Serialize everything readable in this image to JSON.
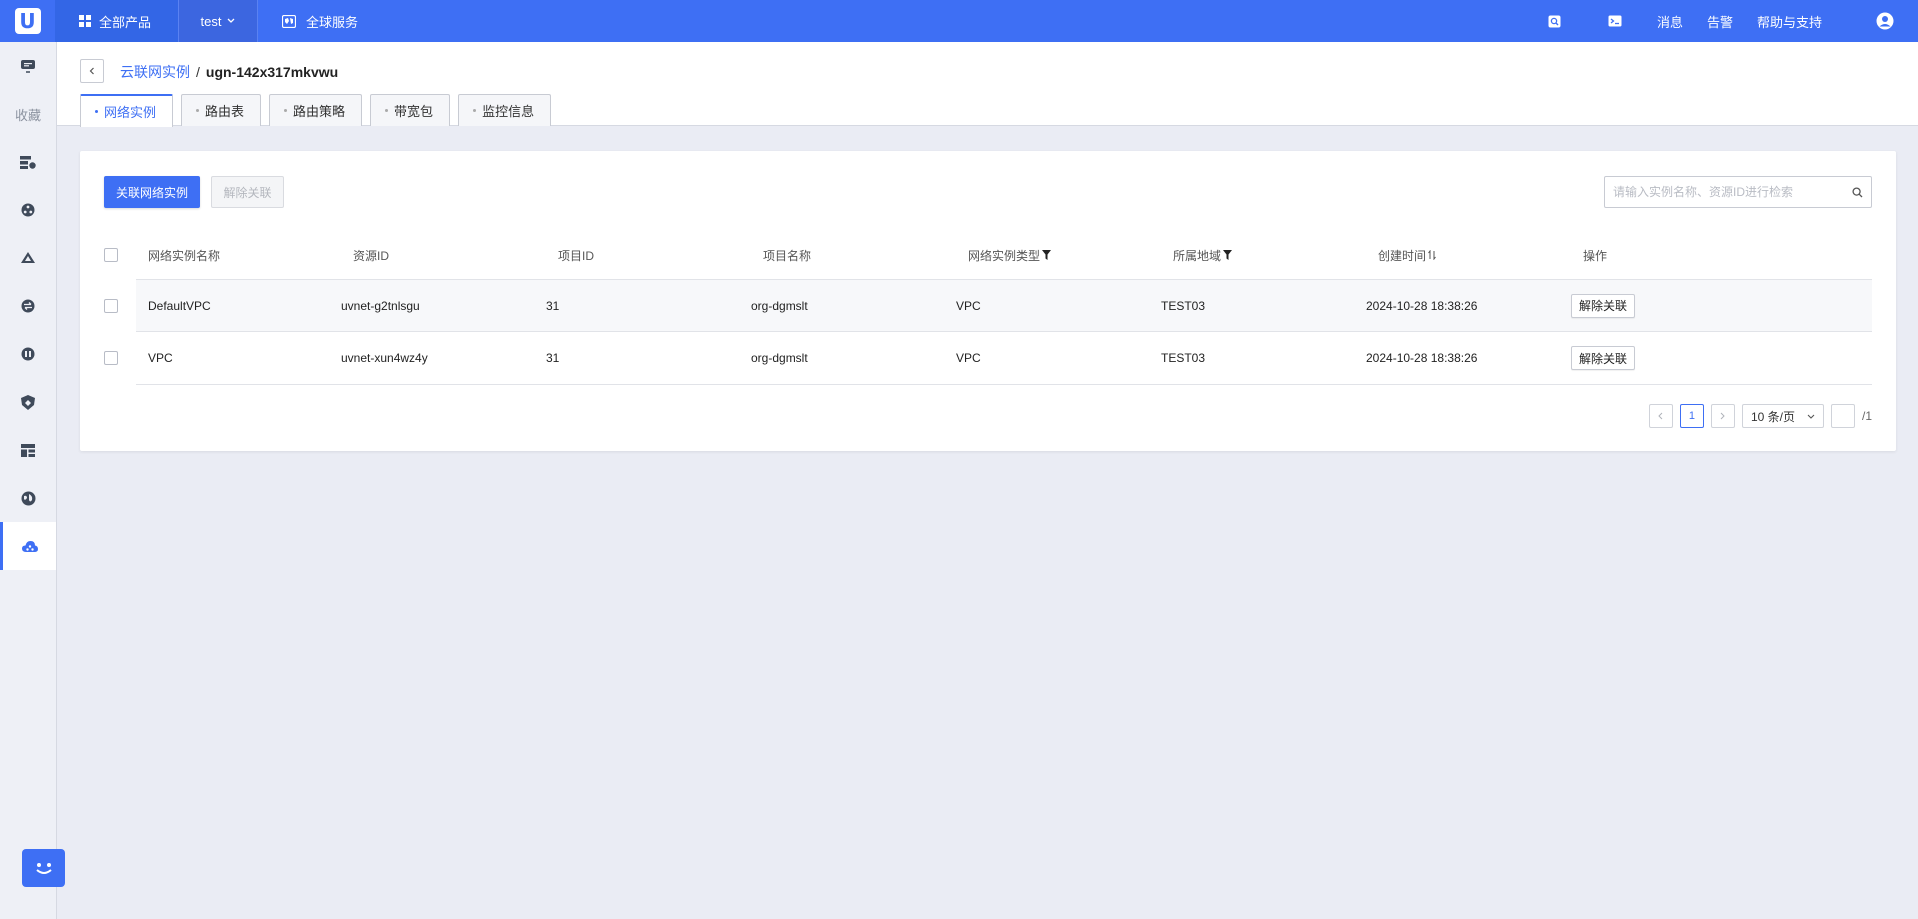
{
  "topbar": {
    "logo": "U",
    "all_products": "全部产品",
    "project": "test",
    "global_service": "全球服务",
    "messages": "消息",
    "alerts": "告警",
    "help": "帮助与支持"
  },
  "sidebar": {
    "favorites": "收藏"
  },
  "header": {
    "breadcrumb_parent": "云联网实例",
    "breadcrumb_sep": "/",
    "breadcrumb_current": "ugn-142x317mkvwu",
    "tabs": [
      {
        "label": "网络实例"
      },
      {
        "label": "路由表"
      },
      {
        "label": "路由策略"
      },
      {
        "label": "带宽包"
      },
      {
        "label": "监控信息"
      }
    ]
  },
  "toolbar": {
    "associate_label": "关联网络实例",
    "disassociate_label": "解除关联",
    "search_placeholder": "请输入实例名称、资源ID进行检索"
  },
  "table": {
    "columns": [
      "网络实例名称",
      "资源ID",
      "项目ID",
      "项目名称",
      "网络实例类型",
      "所属地域",
      "创建时间",
      "操作"
    ],
    "rows": [
      {
        "name": "DefaultVPC",
        "resource_id": "uvnet-g2tnlsgu",
        "project_id": "31",
        "project_name": "org-dgmslt",
        "type": "VPC",
        "region": "TEST03",
        "created": "2024-10-28 18:38:26",
        "action": "解除关联"
      },
      {
        "name": "VPC",
        "resource_id": "uvnet-xun4wz4y",
        "project_id": "31",
        "project_name": "org-dgmslt",
        "type": "VPC",
        "region": "TEST03",
        "created": "2024-10-28 18:38:26",
        "action": "解除关联"
      }
    ]
  },
  "pager": {
    "current": "1",
    "page_size": "10 条/页",
    "total": "/1"
  }
}
